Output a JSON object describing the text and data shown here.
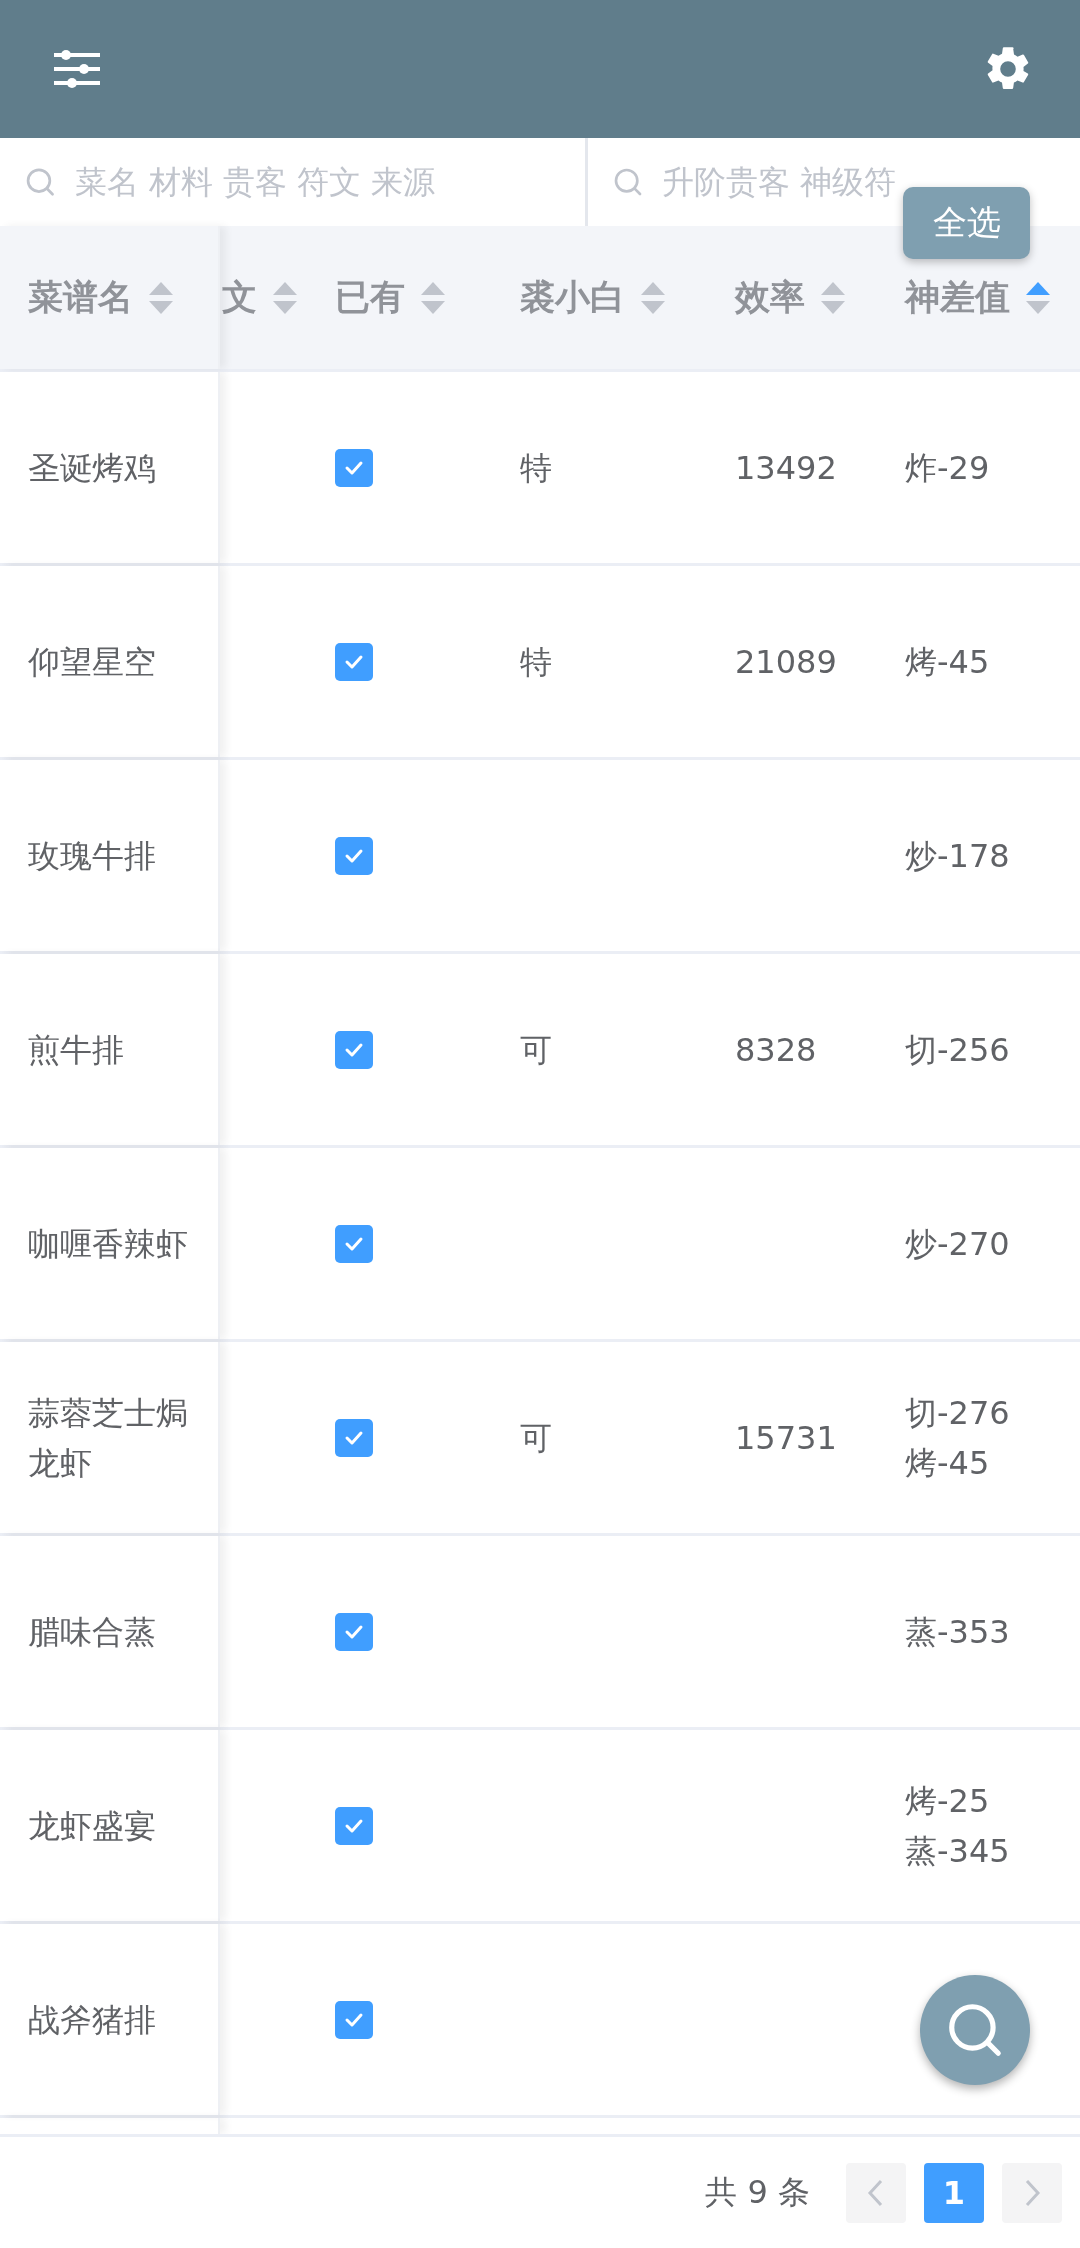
{
  "search_fields": [
    {
      "placeholder": "菜名 材料 贵客 符文 来源"
    },
    {
      "placeholder": "升阶贵客 神级符"
    }
  ],
  "select_all_button": "全选",
  "table": {
    "columns": [
      {
        "label": "菜谱名",
        "sorted_ascending": false
      },
      {
        "label": "文",
        "sorted_ascending": false
      },
      {
        "label": "已有",
        "sorted_ascending": false
      },
      {
        "label": "裘小白",
        "sorted_ascending": false
      },
      {
        "label": "效率",
        "sorted_ascending": false
      },
      {
        "label": "神差值",
        "sorted_ascending": true
      }
    ],
    "rows": [
      {
        "name": "圣诞烤鸡",
        "owned": true,
        "column_4": "特",
        "efficiency": "13492",
        "diff": [
          "炸-29"
        ]
      },
      {
        "name": "仰望星空",
        "owned": true,
        "column_4": "特",
        "efficiency": "21089",
        "diff": [
          "烤-45"
        ]
      },
      {
        "name": "玫瑰牛排",
        "owned": true,
        "diff": [
          "炒-178"
        ]
      },
      {
        "name": "煎牛排",
        "owned": true,
        "column_4": "可",
        "efficiency": "8328",
        "diff": [
          "切-256"
        ]
      },
      {
        "name": "咖喱香辣虾",
        "owned": true,
        "diff": [
          "炒-270"
        ]
      },
      {
        "name": "蒜蓉芝士焗龙虾",
        "owned": true,
        "column_4": "可",
        "efficiency": "15731",
        "diff": [
          "切-276",
          "烤-45"
        ]
      },
      {
        "name": "腊味合蒸",
        "owned": true,
        "diff": [
          "蒸-353"
        ]
      },
      {
        "name": "龙虾盛宴",
        "owned": true,
        "diff": [
          "烤-25",
          "蒸-345"
        ]
      },
      {
        "name": "战斧猪排",
        "owned": true
      }
    ]
  },
  "pagination": {
    "total": "共 9 条",
    "pages": [
      {
        "label": "1",
        "selected": true
      }
    ]
  }
}
